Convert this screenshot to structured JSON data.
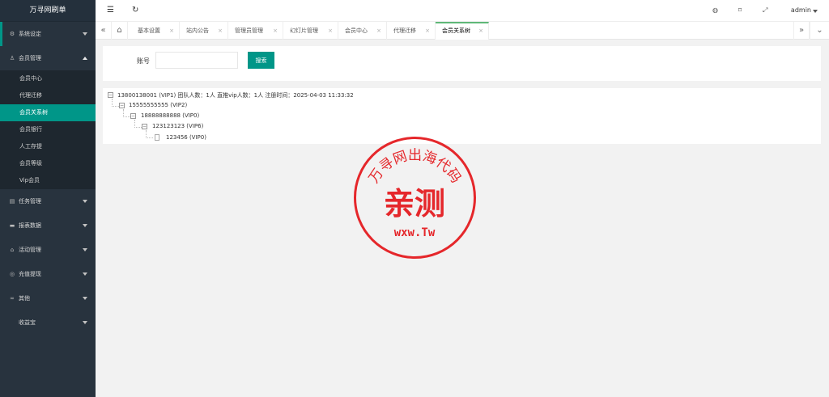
{
  "brand": "万寻网刷单",
  "sidebar": {
    "groups": [
      {
        "label": "系统设定",
        "icon": "gear-icon"
      },
      {
        "label": "会员管理",
        "icon": "user-icon"
      },
      {
        "label": "任务管理",
        "icon": "list-icon"
      },
      {
        "label": "报表数据",
        "icon": "chart-icon"
      },
      {
        "label": "活动管理",
        "icon": "gift-icon"
      },
      {
        "label": "充值提现",
        "icon": "money-icon"
      },
      {
        "label": "其他",
        "icon": "link-icon"
      },
      {
        "label": "收益宝",
        "icon": ""
      }
    ],
    "member_sub": [
      "会员中心",
      "代理迁移",
      "会员关系树",
      "会员银行",
      "人工存提",
      "会员等级",
      "Vip会员"
    ]
  },
  "header": {
    "user": "admin"
  },
  "tabs": [
    "基本设置",
    "站内公告",
    "管理员管理",
    "幻灯片管理",
    "会员中心",
    "代理迁移",
    "会员关系树"
  ],
  "search": {
    "label": "账号",
    "value": "",
    "placeholder": "",
    "button": "搜索"
  },
  "tree": [
    {
      "text": "13800138001  (VIP1) 团队人数：1人 直推vip人数：1人 注册时间：2025-04-03 11:33:32",
      "level": 0,
      "expandable": true
    },
    {
      "text": "15555555555  (VIP2)",
      "level": 1,
      "expandable": true
    },
    {
      "text": "18888888888  (VIP0)",
      "level": 2,
      "expandable": true
    },
    {
      "text": "123123123  (VIP6)",
      "level": 3,
      "expandable": true
    },
    {
      "text": "123456  (VIP0)",
      "level": 4,
      "expandable": false
    }
  ],
  "stamp": {
    "arc": "万寻网出海代码",
    "main": "亲测",
    "domain": "wxw.Tw"
  },
  "colors": {
    "accent": "#009688",
    "sidebar": "#28333e",
    "stamp": "#e5272b"
  }
}
